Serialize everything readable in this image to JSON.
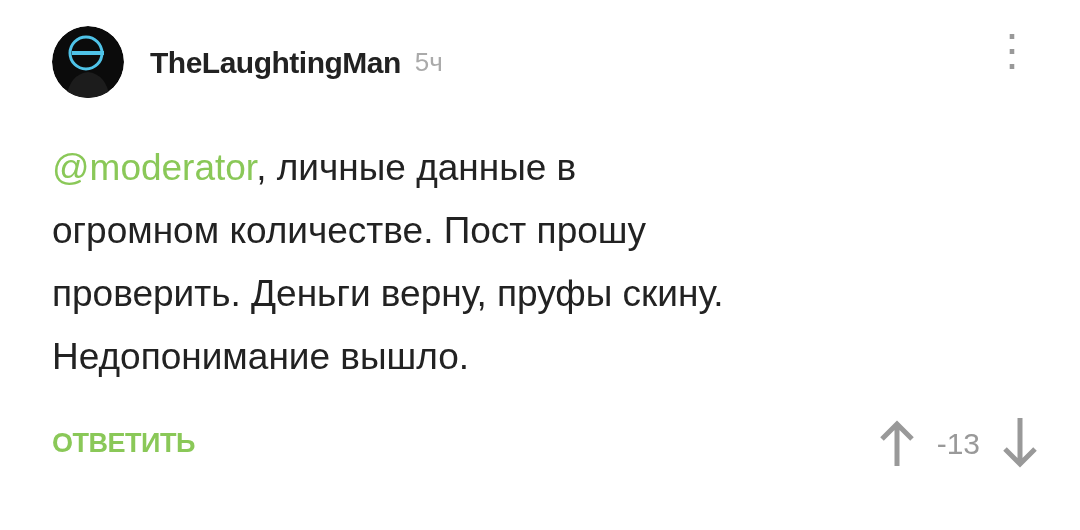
{
  "comment": {
    "author": "TheLaughtingMan",
    "time": "5ч",
    "menu": "⋮",
    "mention": "@moderator",
    "text": ", личные данные в\nогромном количестве. Пост прошу\nпроверить. Деньги верну, пруфы скину.\nНедопонимание вышло.",
    "reply": "ОТВЕТИТЬ",
    "rating": "-13"
  }
}
